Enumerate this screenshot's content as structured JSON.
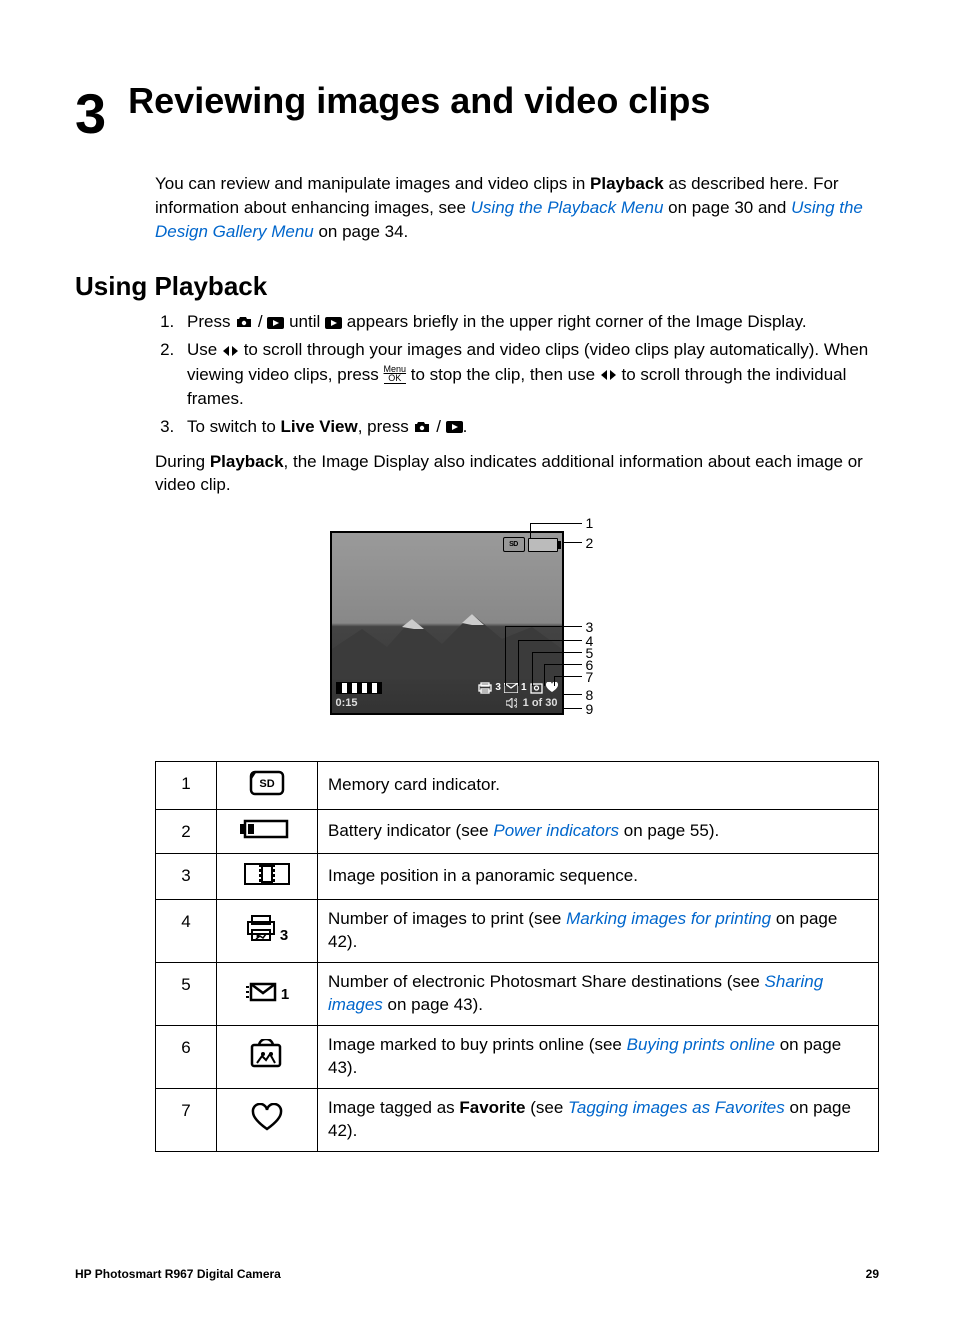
{
  "chapter": {
    "number": "3",
    "title": "Reviewing images and video clips"
  },
  "intro": {
    "part1": "You can review and manipulate images and video clips in ",
    "playback_bold": "Playback",
    "part2": " as described here. For information about enhancing images, see ",
    "link1": "Using the Playback Menu",
    "part3": " on page 30 and ",
    "link2": "Using the Design Gallery Menu",
    "part4": " on page 34."
  },
  "section_heading": "Using Playback",
  "steps": {
    "s1_a": "Press ",
    "s1_b": " until ",
    "s1_c": " appears briefly in the upper right corner of the Image Display.",
    "s2_a": "Use ",
    "s2_b": " to scroll through your images and video clips (video clips play automatically). When viewing video clips, press ",
    "s2_c": " to stop the clip, then use ",
    "s2_d": " to scroll through the individual frames.",
    "s3_a": "To switch to ",
    "s3_live": "Live View",
    "s3_b": ", press ",
    "s3_c": "."
  },
  "during_para": {
    "a": "During ",
    "playback_bold": "Playback",
    "b": ", the Image Display also indicates additional information about each image or video clip."
  },
  "figure_overlay": {
    "print_count": "3",
    "share_count": "1",
    "timer": "0:15",
    "position": "1 of 30"
  },
  "callouts": [
    "1",
    "2",
    "3",
    "4",
    "5",
    "6",
    "7",
    "8",
    "9"
  ],
  "table": {
    "rows": [
      {
        "num": "1",
        "icon": "sd",
        "desc_parts": [
          {
            "t": "Memory card indicator."
          }
        ]
      },
      {
        "num": "2",
        "icon": "battery",
        "desc_parts": [
          {
            "t": "Battery indicator (see "
          },
          {
            "link": "Power indicators"
          },
          {
            "t": " on page 55)."
          }
        ]
      },
      {
        "num": "3",
        "icon": "panorama",
        "desc_parts": [
          {
            "t": "Image position in a panoramic sequence."
          }
        ]
      },
      {
        "num": "4",
        "icon": "print3",
        "desc_parts": [
          {
            "t": "Number of images to print (see "
          },
          {
            "link": "Marking images for printing"
          },
          {
            "t": " on page 42)."
          }
        ]
      },
      {
        "num": "5",
        "icon": "share1",
        "desc_parts": [
          {
            "t": "Number of electronic Photosmart Share destinations (see "
          },
          {
            "link": "Sharing images"
          },
          {
            "t": " on page 43)."
          }
        ]
      },
      {
        "num": "6",
        "icon": "buy",
        "desc_parts": [
          {
            "t": "Image marked to buy prints online (see "
          },
          {
            "link": "Buying prints online"
          },
          {
            "t": " on page 43)."
          }
        ]
      },
      {
        "num": "7",
        "icon": "heart",
        "desc_parts": [
          {
            "t": "Image tagged as "
          },
          {
            "bold": "Favorite"
          },
          {
            "t": " (see "
          },
          {
            "link": "Tagging images as Favorites"
          },
          {
            "t": " on page 42)."
          }
        ]
      }
    ]
  },
  "footer": {
    "left": "HP Photosmart R967 Digital Camera",
    "right": "29"
  }
}
